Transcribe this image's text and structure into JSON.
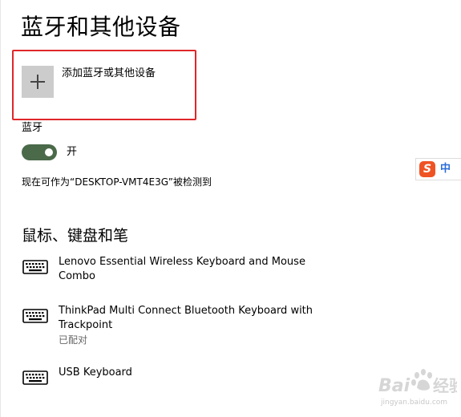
{
  "page": {
    "title": "蓝牙和其他设备"
  },
  "add_device": {
    "label": "添加蓝牙或其他设备",
    "icon": "plus-icon"
  },
  "bluetooth": {
    "section_label": "蓝牙",
    "toggle_on": true,
    "toggle_state_label": "开",
    "discoverable_text": "现在可作为“DESKTOP-VMT4E3G”被检测到"
  },
  "peripherals": {
    "heading": "鼠标、键盘和笔",
    "devices": [
      {
        "name": "Lenovo Essential Wireless Keyboard and Mouse Combo",
        "status": "",
        "icon": "keyboard-icon"
      },
      {
        "name": "ThinkPad Multi Connect Bluetooth Keyboard with Trackpoint",
        "status": "已配对",
        "icon": "keyboard-icon"
      },
      {
        "name": "USB Keyboard",
        "status": "",
        "icon": "keyboard-icon"
      }
    ]
  },
  "ime": {
    "logo": "S",
    "mode": "中"
  },
  "watermark": {
    "brand": "Bai 经验",
    "url": "jingyan.baidu.com"
  },
  "colors": {
    "highlight_border": "#e0262a",
    "toggle_on": "#4a6a4a",
    "add_tile": "#cccccc",
    "ime_logo": "#ef5323",
    "ime_mode": "#2a6dd8"
  }
}
